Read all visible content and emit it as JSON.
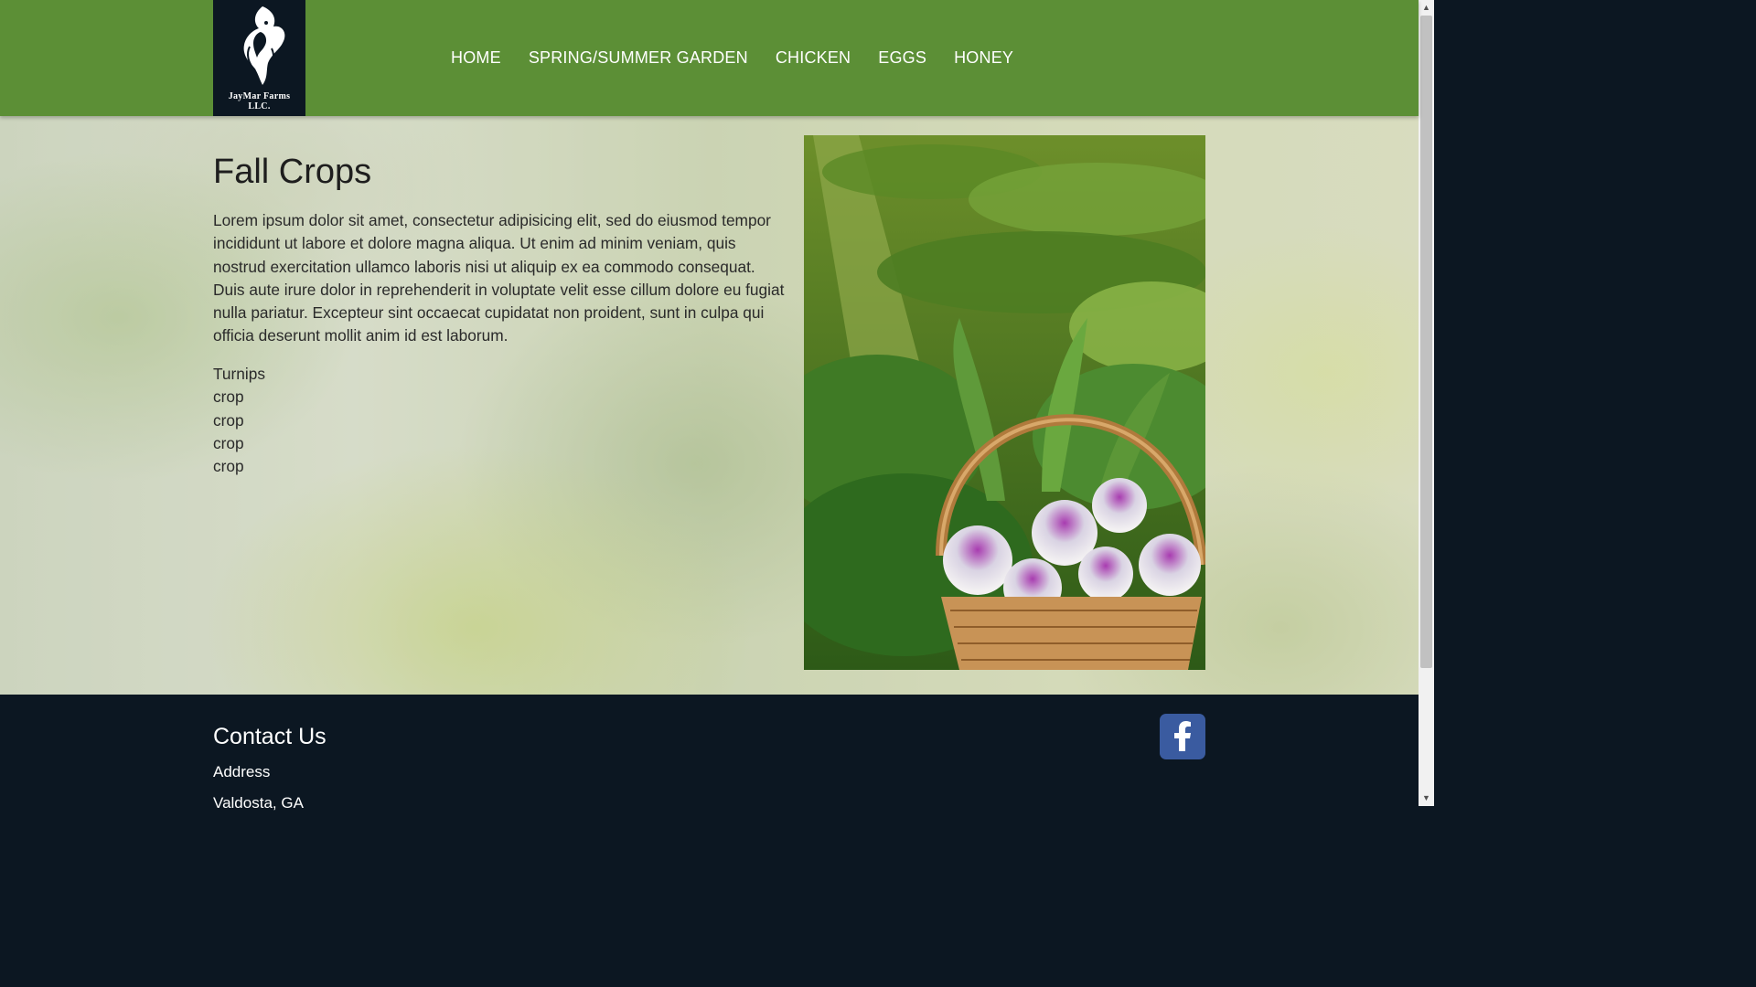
{
  "logo": {
    "line1": "JayMar Farms",
    "line2": "LLC."
  },
  "nav": {
    "items": [
      {
        "label": "HOME"
      },
      {
        "label": "SPRING/SUMMER GARDEN"
      },
      {
        "label": "CHICKEN"
      },
      {
        "label": "EGGS"
      },
      {
        "label": "HONEY"
      }
    ]
  },
  "main": {
    "title": "Fall Crops",
    "intro": "Lorem ipsum dolor sit amet, consectetur adipisicing elit, sed do eiusmod tempor incididunt ut labore et dolore magna aliqua. Ut enim ad minim veniam, quis nostrud exercitation ullamco laboris nisi ut aliquip ex ea commodo consequat. Duis aute irure dolor in reprehenderit in voluptate velit esse cillum dolore eu fugiat nulla pariatur. Excepteur sint occaecat cupidatat non proident, sunt in culpa qui officia deserunt mollit anim id est laborum.",
    "crops": [
      "Turnips",
      "crop",
      "crop",
      "crop",
      "crop"
    ]
  },
  "footer": {
    "title": "Contact Us",
    "address_label": "Address",
    "city": "Valdosta, GA",
    "facebook_glyph": "f"
  },
  "colors": {
    "header_bg": "#5c8f36",
    "footer_bg": "#0c1722",
    "facebook_blue": "#3a5ba0"
  }
}
